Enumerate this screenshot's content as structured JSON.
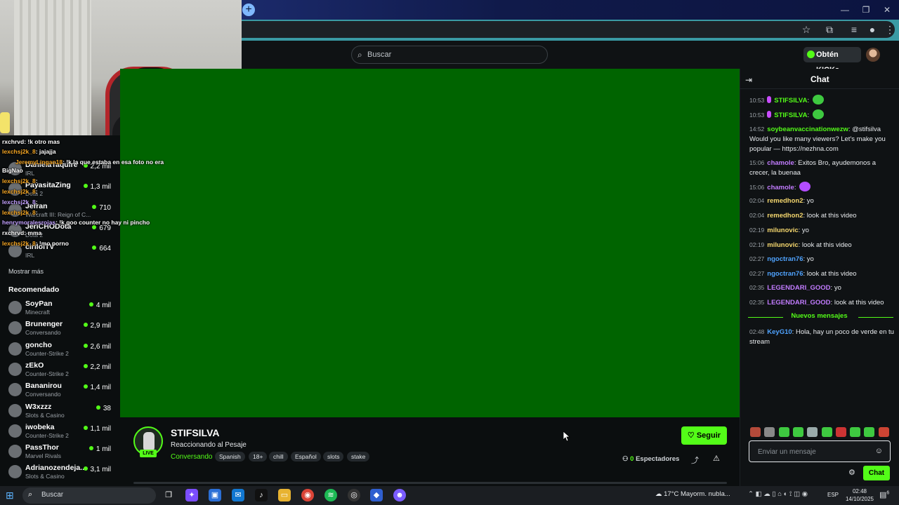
{
  "browser": {
    "new_tab_icon": "plus-icon",
    "minimize": "—",
    "restore": "❐",
    "close": "✕"
  },
  "header": {
    "search_placeholder": "Buscar",
    "kicks_label": "Obtén KICKs"
  },
  "overlay_chat": [
    {
      "user": "rxchrvd",
      "msg": ": !k otro mas"
    },
    {
      "user": "lexchsj2k_8",
      "msg": ": jajajja"
    },
    {
      "user": "JeremyLingan18",
      "msg": ": !k la que estaba en esa foto no era"
    },
    {
      "user": "BigNao",
      "msg": ""
    },
    {
      "user": "lexchsj2k_8",
      "msg": ":"
    },
    {
      "user": "lexchsj2k_8",
      "msg": ":"
    },
    {
      "user": "lexchsj2k_8",
      "msg": ":"
    },
    {
      "user": "lexchsj2k_8",
      "msg": ":"
    },
    {
      "user": "henrymoralesrojas",
      "msg": ": !k goo counter no hay ni pincho"
    },
    {
      "user": "rxchrvd",
      "msg": ": mma"
    },
    {
      "user": "lexchsj2k_8",
      "msg": ": !mo porno"
    }
  ],
  "sidebar": {
    "following": [
      {
        "name": "DanielaTaquire",
        "category": "IRL",
        "viewers": "2,2 mil"
      },
      {
        "name": "PayasitaZing",
        "category": "Dota 2",
        "viewers": "1,3 mil"
      },
      {
        "name": "Jefran",
        "category": "Warcraft III: Reign of C...",
        "viewers": "710"
      },
      {
        "name": "JeriCHODota",
        "category": "Dota 2",
        "viewers": "679"
      },
      {
        "name": "cirilolTV",
        "category": "IRL",
        "viewers": "664"
      }
    ],
    "show_more": "Mostrar más",
    "recommended_title": "Recomendado",
    "recommended": [
      {
        "name": "SoyPan",
        "category": "Minecraft",
        "viewers": "4 mil"
      },
      {
        "name": "Brunenger",
        "category": "Conversando",
        "viewers": "2,9 mil"
      },
      {
        "name": "goncho",
        "category": "Counter-Strike 2",
        "viewers": "2,6 mil"
      },
      {
        "name": "zEkO",
        "category": "Counter-Strike 2",
        "viewers": "2,2 mil"
      },
      {
        "name": "Bananirou",
        "category": "Conversando",
        "viewers": "1,4 mil"
      },
      {
        "name": "W3xzzz",
        "category": "Slots & Casino",
        "viewers": "38"
      },
      {
        "name": "iwobeka",
        "category": "Counter-Strike 2",
        "viewers": "1,1 mil"
      },
      {
        "name": "PassThor",
        "category": "Marvel Rivals",
        "viewers": "1 mil"
      },
      {
        "name": "Adrianozendeja...",
        "category": "Slots & Casino",
        "viewers": "3,1 mil"
      }
    ]
  },
  "stream": {
    "streamer": "STIFSILVA",
    "live_label": "LIVE",
    "title": "Reaccionando al Pesaje",
    "category": "Conversando",
    "tags": [
      "Spanish",
      "18+",
      "chill",
      "Español",
      "slots",
      "stake"
    ],
    "follow_label": "Seguir",
    "viewers_count": "0",
    "viewers_label": "Espectadores"
  },
  "chat": {
    "title": "Chat",
    "messages": [
      {
        "time": "10:53",
        "user": "STIFSILVA",
        "color": "#53fc18",
        "text": "",
        "mic": true,
        "emote": "green"
      },
      {
        "time": "10:53",
        "user": "STIFSILVA",
        "color": "#53fc18",
        "text": "",
        "mic": true,
        "emote": "green"
      },
      {
        "time": "14:52",
        "user": "soybeanvaccinationwezw",
        "color": "#53fc18",
        "text": "@stifsilva Would you like many viewers? Let's make you popular — https://nezhna.com"
      },
      {
        "time": "15:06",
        "user": "chamole",
        "color": "#c27cff",
        "text": "Exitos Bro, ayudemonos a crecer, la buenaa"
      },
      {
        "time": "15:06",
        "user": "chamole",
        "color": "#c27cff",
        "text": "",
        "emote": "purple"
      },
      {
        "time": "02:04",
        "user": "remedhon2",
        "color": "#f5d76e",
        "text": "yo"
      },
      {
        "time": "02:04",
        "user": "remedhon2",
        "color": "#f5d76e",
        "text": "look at this video"
      },
      {
        "time": "02:19",
        "user": "milunovic",
        "color": "#f5d76e",
        "text": "yo"
      },
      {
        "time": "02:19",
        "user": "milunovic",
        "color": "#f5d76e",
        "text": "look at this video"
      },
      {
        "time": "02:27",
        "user": "ngoctran76",
        "color": "#4fa3ff",
        "text": "yo"
      },
      {
        "time": "02:27",
        "user": "ngoctran76",
        "color": "#4fa3ff",
        "text": "look at this video"
      },
      {
        "time": "02:35",
        "user": "LEGENDARI_GOOD",
        "color": "#c27cff",
        "text": "yo"
      },
      {
        "time": "02:35",
        "user": "LEGENDARI_GOOD",
        "color": "#c27cff",
        "text": "look at this video"
      }
    ],
    "new_messages_label": "Nuevos mensajes",
    "new_messages": [
      {
        "time": "02:48",
        "user": "KeyG10",
        "color": "#4fa3ff",
        "text": "Hola, hay un poco de verde en tu stream"
      }
    ],
    "input_placeholder": "Enviar un mensaje",
    "send_label": "Chat"
  },
  "taskbar": {
    "search_label": "Buscar",
    "weather_temp": "17°C",
    "weather_desc": "Mayorm. nubla...",
    "lang": "ESP",
    "time": "02:48",
    "date": "14/10/2025",
    "notif_count": "6"
  }
}
